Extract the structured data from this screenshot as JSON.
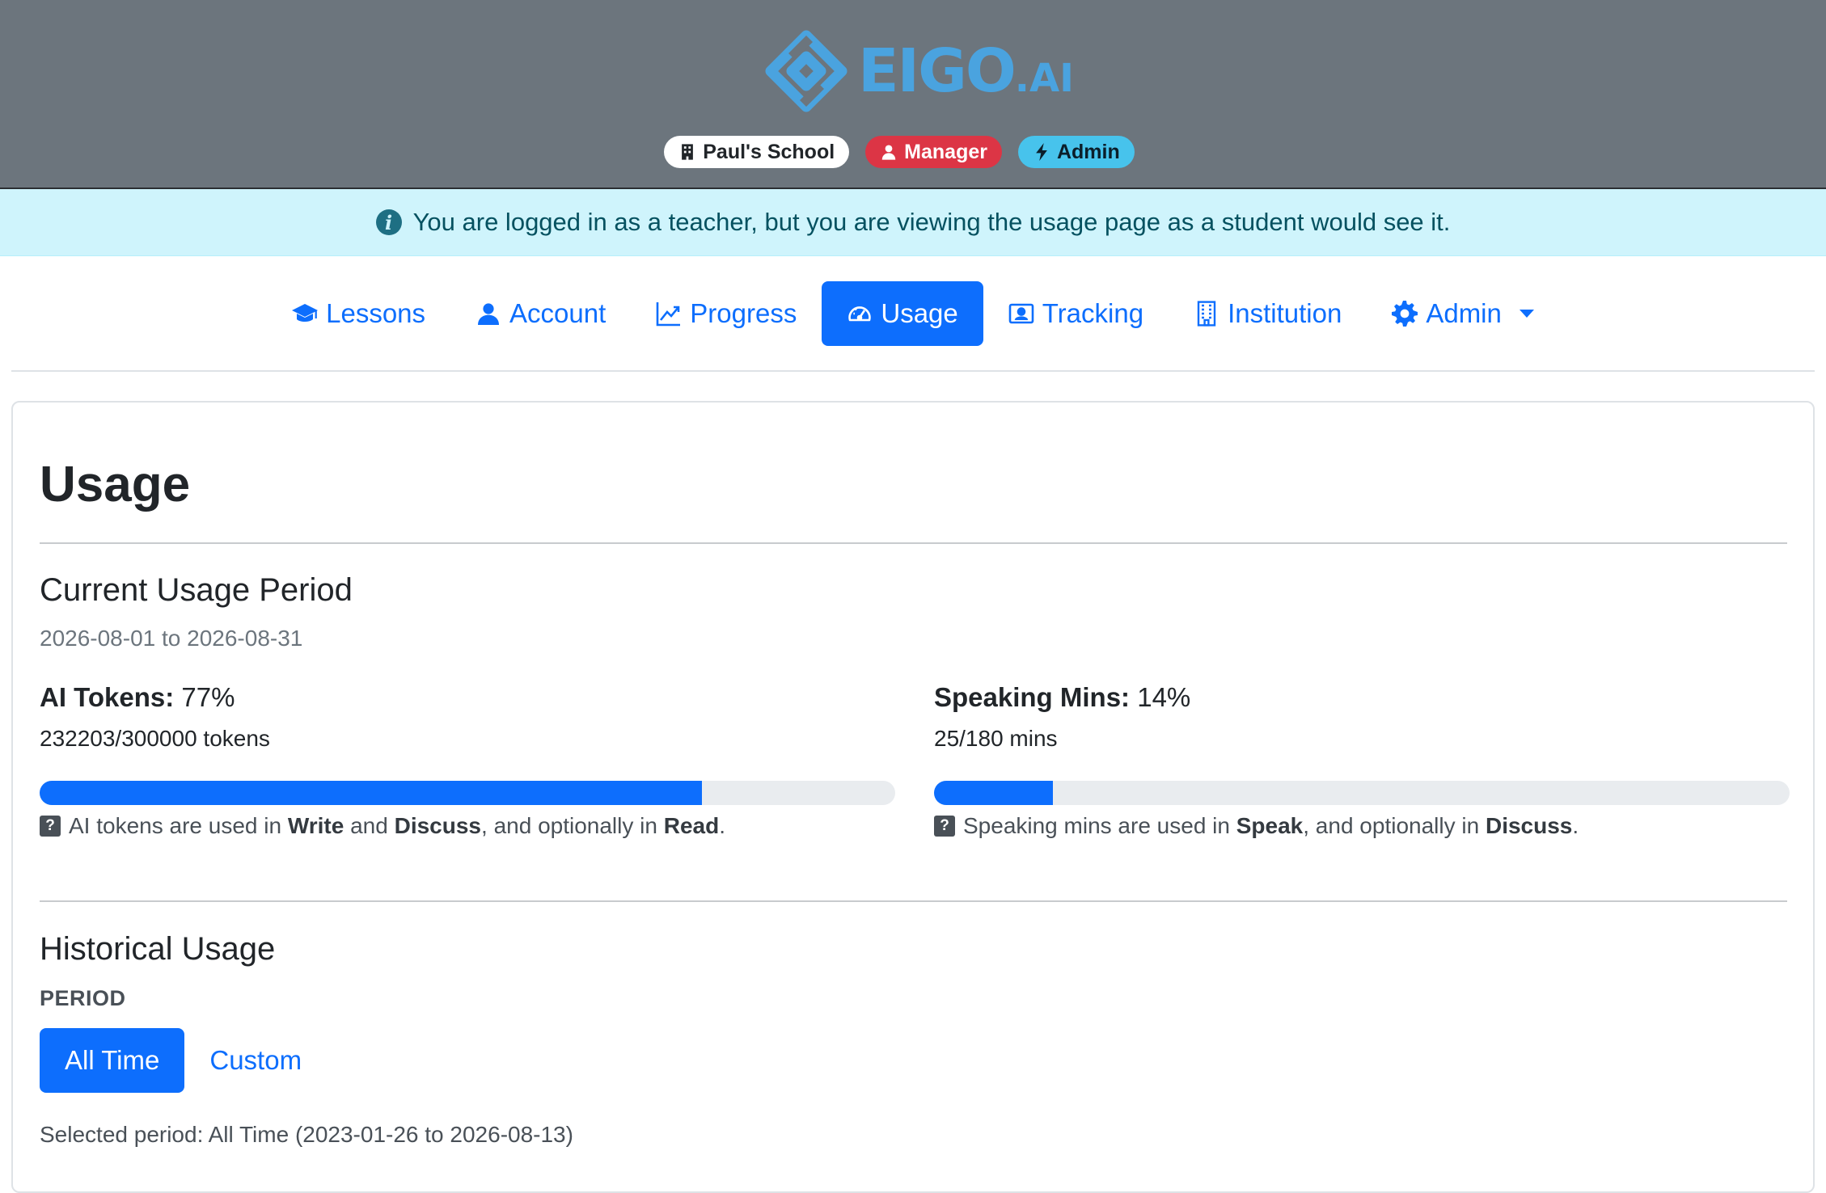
{
  "header": {
    "logo_text": "EIGO",
    "logo_suffix": ".AI",
    "badges": [
      {
        "label": "Paul's School",
        "icon": "building-icon"
      },
      {
        "label": "Manager",
        "icon": "person-icon"
      },
      {
        "label": "Admin",
        "icon": "lightning-icon"
      }
    ]
  },
  "banner": {
    "icon": "info-icon",
    "text": "You are logged in as a teacher, but you are viewing the usage page as a student would see it."
  },
  "nav": {
    "items": [
      {
        "label": "Lessons",
        "icon": "graduation-cap-icon"
      },
      {
        "label": "Account",
        "icon": "person-icon"
      },
      {
        "label": "Progress",
        "icon": "chart-line-icon"
      },
      {
        "label": "Usage",
        "icon": "speedometer-icon",
        "active": true
      },
      {
        "label": "Tracking",
        "icon": "person-badge-icon"
      },
      {
        "label": "Institution",
        "icon": "building-icon"
      },
      {
        "label": "Admin",
        "icon": "gear-icon",
        "dropdown": true
      }
    ]
  },
  "page": {
    "title": "Usage",
    "current": {
      "title": "Current Usage Period",
      "range": "2026-08-01 to 2026-08-31",
      "tokens": {
        "label": "AI Tokens:",
        "percent": "77%",
        "detail": "232203/300000 tokens",
        "fraction": 0.774,
        "note_prefix": "AI tokens are used in ",
        "note_b1": "Write",
        "note_mid": " and ",
        "note_b2": "Discuss",
        "note_mid2": ", and optionally in ",
        "note_b3": "Read",
        "note_end": "."
      },
      "speaking": {
        "label": "Speaking Mins:",
        "percent": "14%",
        "detail": "25/180 mins",
        "fraction": 0.139,
        "note_prefix": "Speaking mins are used in ",
        "note_b1": "Speak",
        "note_mid": ", and optionally in ",
        "note_b2": "Discuss",
        "note_end": "."
      }
    },
    "historical": {
      "title": "Historical Usage",
      "period_label": "PERIOD",
      "btn_all": "All Time",
      "btn_custom": "Custom",
      "selected": "Selected period: All Time (2023-01-26 to 2026-08-13)"
    }
  },
  "colors": {
    "primary": "#0d6efd",
    "header_bg": "#6c757d",
    "banner_bg": "#cff4fc",
    "manager_badge": "#dc3545",
    "admin_badge": "#47c3ec",
    "logo": "#4aa3df"
  }
}
